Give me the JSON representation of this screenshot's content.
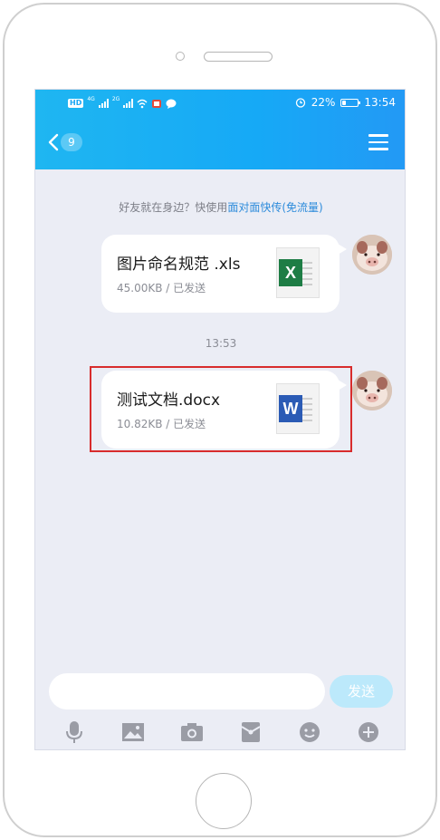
{
  "status_bar": {
    "network_labels": [
      "4G",
      "2G"
    ],
    "battery_text": "22%",
    "battery_level": 0.22,
    "time": "13:54"
  },
  "header": {
    "unread_count": "9"
  },
  "notice": {
    "prefix": "好友就在身边？快使用",
    "link": "面对面快传(免流量)"
  },
  "messages": [
    {
      "file_name": "图片命名规范 .xls",
      "meta": "45.00KB / 已发送",
      "file_type_icon": "excel-icon",
      "icon_letter": "X"
    },
    {
      "file_name": "测试文档.docx",
      "meta": "10.82KB / 已发送",
      "file_type_icon": "word-icon",
      "icon_letter": "W"
    }
  ],
  "timestamp": "13:53",
  "composer": {
    "placeholder": "",
    "send_label": "发送"
  },
  "toolbar": {
    "items": [
      "microphone-icon",
      "image-icon",
      "camera-icon",
      "red-packet-icon",
      "emoji-icon",
      "plus-icon"
    ]
  },
  "colors": {
    "header_blue": "#19a7f5",
    "background": "#ebedf5",
    "link": "#2c8bdb",
    "highlight": "#d82c2c",
    "send_button": "#bce9fb",
    "excel_green": "#1e7d45",
    "word_blue": "#2b5bb5"
  }
}
